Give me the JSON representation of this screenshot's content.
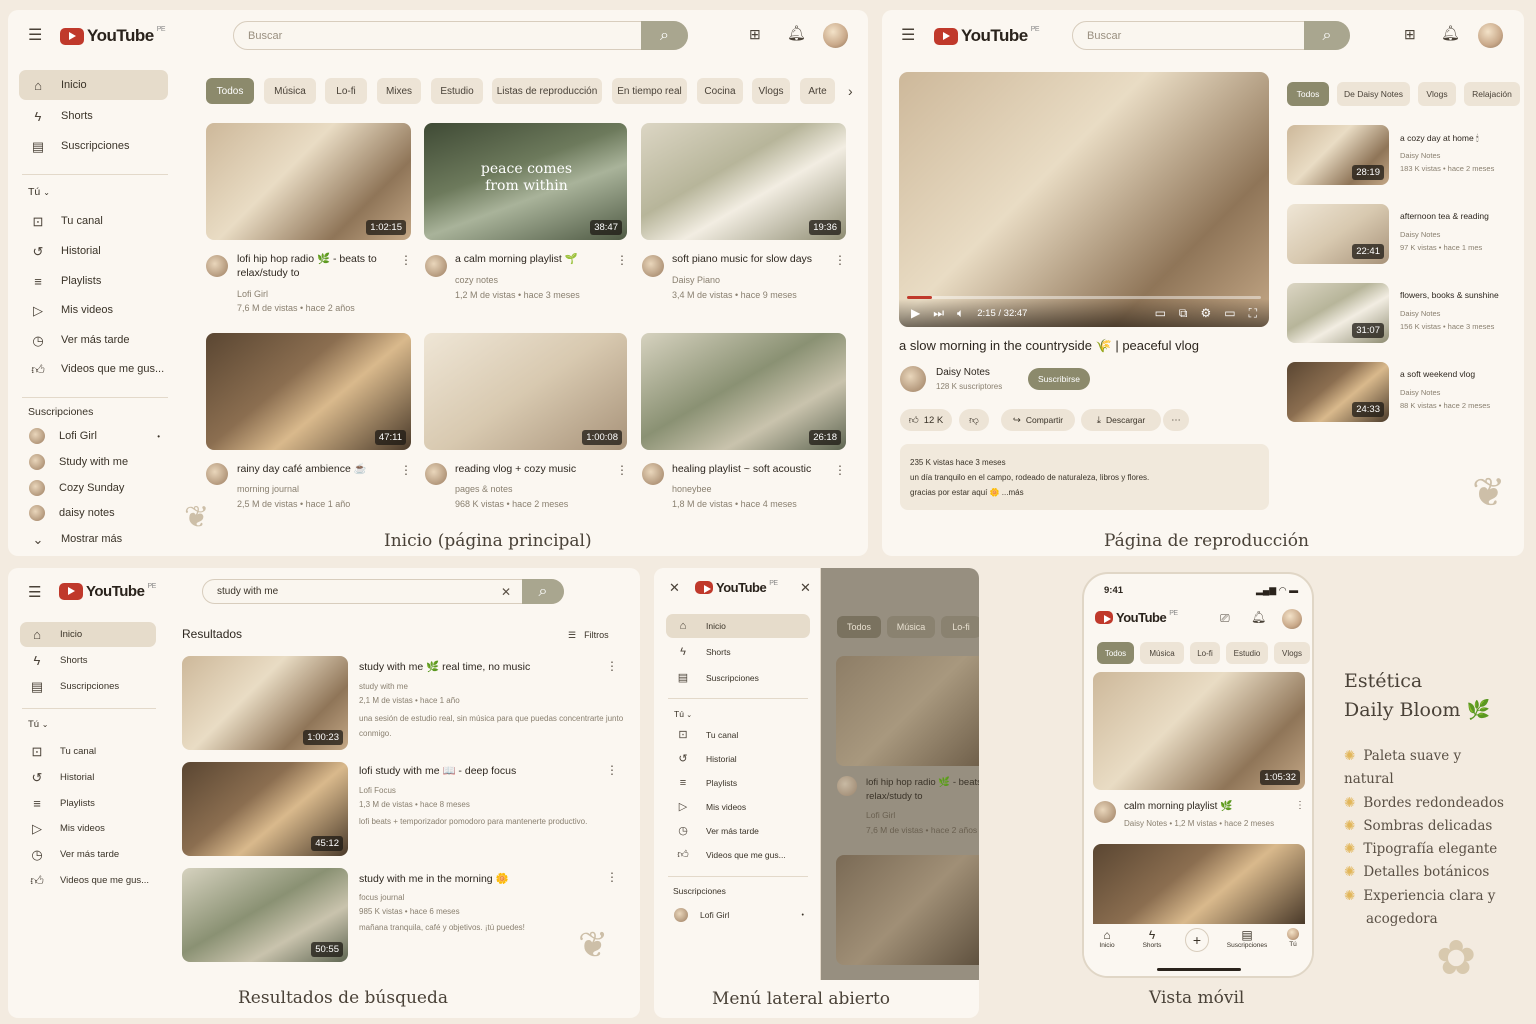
{
  "brand": {
    "logo": "YouTube",
    "region": "PE"
  },
  "colors": {
    "accent": "#8c8a6c",
    "background": "#f3ebe0",
    "panel": "#fbf7f1"
  },
  "home": {
    "search_placeholder": "Buscar",
    "sidebar": {
      "main": [
        {
          "label": "Inicio",
          "icon": "home-icon"
        },
        {
          "label": "Shorts",
          "icon": "shorts-icon"
        },
        {
          "label": "Suscripciones",
          "icon": "subscriptions-icon"
        }
      ],
      "you_title": "Tú",
      "you": [
        {
          "label": "Tu canal"
        },
        {
          "label": "Historial"
        },
        {
          "label": "Playlists"
        },
        {
          "label": "Mis videos"
        },
        {
          "label": "Ver más tarde"
        },
        {
          "label": "Videos que me gus..."
        }
      ],
      "subs_title": "Suscripciones",
      "subs": [
        {
          "label": "Lofi Girl"
        },
        {
          "label": "Study with me"
        },
        {
          "label": "Cozy Sunday"
        },
        {
          "label": "daisy notes"
        }
      ],
      "more": "Mostrar más"
    },
    "chips": [
      "Todos",
      "Música",
      "Lo-fi",
      "Mixes",
      "Estudio",
      "Listas de reproducción",
      "En tiempo real",
      "Cocina",
      "Vlogs",
      "Arte"
    ],
    "videos": [
      {
        "title": "lofi hip hop radio 🌿 - beats to relax/study to",
        "channel": "Lofi Girl",
        "meta": "7,6 M de vistas • hace 2 años",
        "duration": "1:02:15"
      },
      {
        "title": "a calm morning playlist 🌱",
        "channel": "cozy notes",
        "meta": "1,2 M de vistas • hace 3 meses",
        "duration": "38:47",
        "overlay": "peace comes from within"
      },
      {
        "title": "soft piano music for slow days",
        "channel": "Daisy Piano",
        "meta": "3,4 M de vistas • hace 9 meses",
        "duration": "19:36"
      },
      {
        "title": "rainy day café ambience ☕",
        "channel": "morning journal",
        "meta": "2,5 M de vistas • hace 1 año",
        "duration": "47:11"
      },
      {
        "title": "reading vlog + cozy music",
        "channel": "pages & notes",
        "meta": "968 K vistas • hace 2 meses",
        "duration": "1:00:08"
      },
      {
        "title": "healing playlist ~ soft acoustic",
        "channel": "honeybee",
        "meta": "1,8 M de vistas • hace 4 meses",
        "duration": "26:18"
      }
    ],
    "caption": "Inicio (página principal)"
  },
  "watch": {
    "search_placeholder": "Buscar",
    "time": "2:15 / 32:47",
    "progress": 0.07,
    "title": "a slow morning in the countryside 🌾 | peaceful vlog",
    "channel": "Daisy Notes",
    "subs": "128 K suscriptores",
    "subscribe": "Suscribirse",
    "likes": "12 K",
    "share": "Compartir",
    "download": "Descargar",
    "desc_meta": "235 K vistas  hace 3 meses",
    "desc_line": "un día tranquilo en el campo, rodeado de naturaleza, libros y flores.",
    "desc_line2": "gracias por estar aquí 🌼  ...más",
    "chips": [
      "Todos",
      "De Daisy Notes",
      "Vlogs",
      "Relajación"
    ],
    "related": [
      {
        "title": "a cozy day at home 🕯",
        "channel": "Daisy Notes",
        "meta": "183 K vistas • hace 2 meses",
        "duration": "28:19"
      },
      {
        "title": "afternoon tea & reading",
        "channel": "Daisy Notes",
        "meta": "97 K vistas • hace 1 mes",
        "duration": "22:41"
      },
      {
        "title": "flowers, books & sunshine",
        "channel": "Daisy Notes",
        "meta": "156 K vistas • hace 3 meses",
        "duration": "31:07"
      },
      {
        "title": "a soft weekend vlog",
        "channel": "Daisy Notes",
        "meta": "88 K vistas • hace 2 meses",
        "duration": "24:33"
      }
    ],
    "caption": "Página de reproducción"
  },
  "results": {
    "query": "study with me",
    "heading": "Resultados",
    "filters": "Filtros",
    "sidebar": {
      "main": [
        {
          "label": "Inicio"
        },
        {
          "label": "Shorts"
        },
        {
          "label": "Suscripciones"
        }
      ],
      "you_title": "Tú",
      "you": [
        {
          "label": "Tu canal"
        },
        {
          "label": "Historial"
        },
        {
          "label": "Playlists"
        },
        {
          "label": "Mis videos"
        },
        {
          "label": "Ver más tarde"
        },
        {
          "label": "Videos que me gus..."
        }
      ]
    },
    "items": [
      {
        "title": "study with me 🌿 real time, no music",
        "channel": "study with me",
        "meta": "2,1 M de vistas • hace 1 año",
        "desc": "una sesión de estudio real, sin música para que puedas concentrarte junto conmigo.",
        "duration": "1:00:23"
      },
      {
        "title": "lofi study with me 📖 - deep focus",
        "channel": "Lofi Focus",
        "meta": "1,3 M de vistas • hace 8 meses",
        "desc": "lofi beats + temporizador pomodoro para mantenerte productivo.",
        "duration": "45:12"
      },
      {
        "title": "study with me in the morning 🌼",
        "channel": "focus journal",
        "meta": "985 K vistas • hace 6 meses",
        "desc": "mañana tranquila, café y objetivos. ¡tú puedes!",
        "duration": "50:55"
      }
    ],
    "caption": "Resultados de búsqueda"
  },
  "drawer": {
    "main": [
      {
        "label": "Inicio"
      },
      {
        "label": "Shorts"
      },
      {
        "label": "Suscripciones"
      }
    ],
    "you_title": "Tú",
    "you": [
      {
        "label": "Tu canal"
      },
      {
        "label": "Historial"
      },
      {
        "label": "Playlists"
      },
      {
        "label": "Mis videos"
      },
      {
        "label": "Ver más tarde"
      },
      {
        "label": "Videos que me gus..."
      }
    ],
    "subs_title": "Suscripciones",
    "subs": [
      {
        "label": "Lofi Girl"
      }
    ],
    "bg_chips": [
      "Todos",
      "Música",
      "Lo-fi"
    ],
    "bg_title": "lofi hip hop radio 🌿 - beats to relax/study to",
    "bg_channel": "Lofi Girl",
    "bg_meta": "7,6 M de vistas • hace 2 años",
    "caption": "Menú lateral abierto"
  },
  "mobile": {
    "clock": "9:41",
    "chips": [
      "Todos",
      "Música",
      "Lo-fi",
      "Estudio",
      "Vlogs"
    ],
    "video_title": "calm morning playlist 🌿",
    "video_meta": "Daisy Notes • 1,2 M vistas • hace 2 meses",
    "duration": "1:05:32",
    "tabs": [
      "Inicio",
      "Shorts",
      "",
      "Suscripciones",
      "Tú"
    ],
    "caption": "Vista móvil"
  },
  "aesthetic": {
    "title1": "Estética",
    "title2": "Daily Bloom 🌿",
    "features": [
      "Paleta suave y natural",
      "Bordes redondeados",
      "Sombras delicadas",
      "Tipografía elegante",
      "Detalles botánicos",
      "Experiencia clara y acogedora"
    ]
  }
}
